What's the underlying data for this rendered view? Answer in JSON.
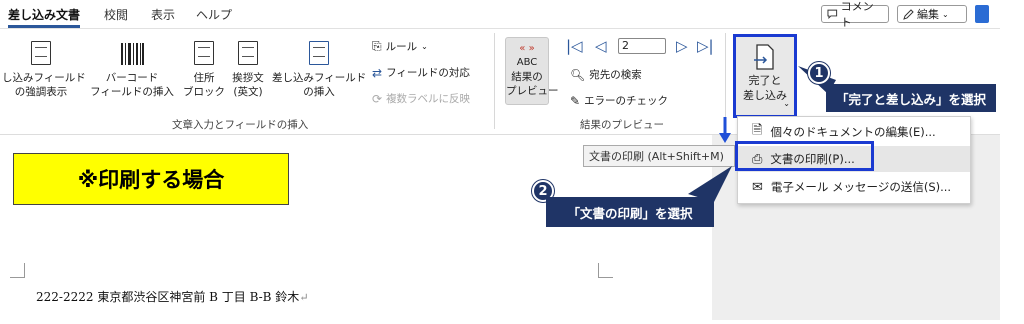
{
  "tabs": [
    "差し込み文書",
    "校閲",
    "表示",
    "ヘルプ"
  ],
  "top_right": {
    "comment": "コメント",
    "edit": "編集"
  },
  "ribbon": {
    "highlight_fields": "し込みフィールド\nの強調表示",
    "barcode": "バーコード\nフィールドの挿入",
    "address_block": "住所\nブロック",
    "greeting": "挨拶文\n(英文)",
    "insert_field": "差し込みフィールド\nの挿入",
    "rules": "ルール",
    "match_fields": "フィールドの対応",
    "update_labels": "複数ラベルに反映",
    "group_write": "文章入力とフィールドの挿入",
    "preview_results": "結果の\nプレビュー",
    "abc": "ABC",
    "record_number": "2",
    "find_recipient": "宛先の検索",
    "check_errors": "エラーのチェック",
    "group_preview": "結果のプレビュー",
    "finish_merge": "完了と\n差し込み"
  },
  "dropdown": {
    "edit_individual": "個々のドキュメントの編集(E)...",
    "print_documents": "文書の印刷(P)...",
    "send_email": "電子メール メッセージの送信(S)..."
  },
  "tooltip": "文書の印刷 (Alt+Shift+M)",
  "document": {
    "heading": "※印刷する場合",
    "address": "222-2222 東京都渋谷区神宮前 B 丁目 B-B 鈴木"
  },
  "callouts": {
    "step1_num": "1",
    "step1_text": "「完了と差し込み」を選択",
    "step2_num": "2",
    "step2_text": "「文書の印刷」を選択"
  },
  "colors": {
    "callout": "#1f3466",
    "highlight_border": "#1a3ad1",
    "yellow": "#ffff00",
    "accent": "#2b579a"
  }
}
